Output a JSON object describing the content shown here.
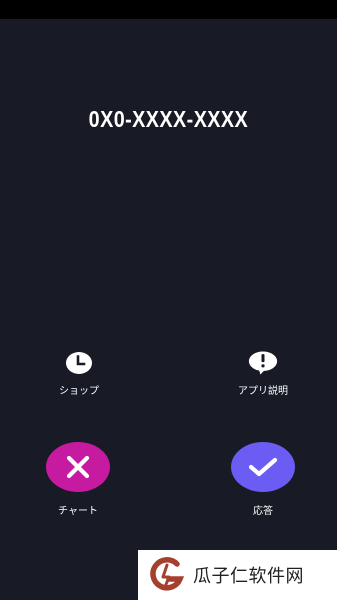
{
  "call": {
    "number": "0X0-XXXX-XXXX"
  },
  "actions": {
    "shop": {
      "label": "ショップ",
      "icon": "clock-icon"
    },
    "app_info": {
      "label": "アプリ説明",
      "icon": "alert-bubble-icon"
    },
    "chart": {
      "label": "チャート",
      "icon": "close-icon",
      "color": "#c61aa0"
    },
    "answer": {
      "label": "応答",
      "icon": "check-icon",
      "color": "#6b5cf4"
    }
  },
  "watermark": {
    "text": "瓜子仁软件网",
    "logo_color": "#a6402e"
  }
}
